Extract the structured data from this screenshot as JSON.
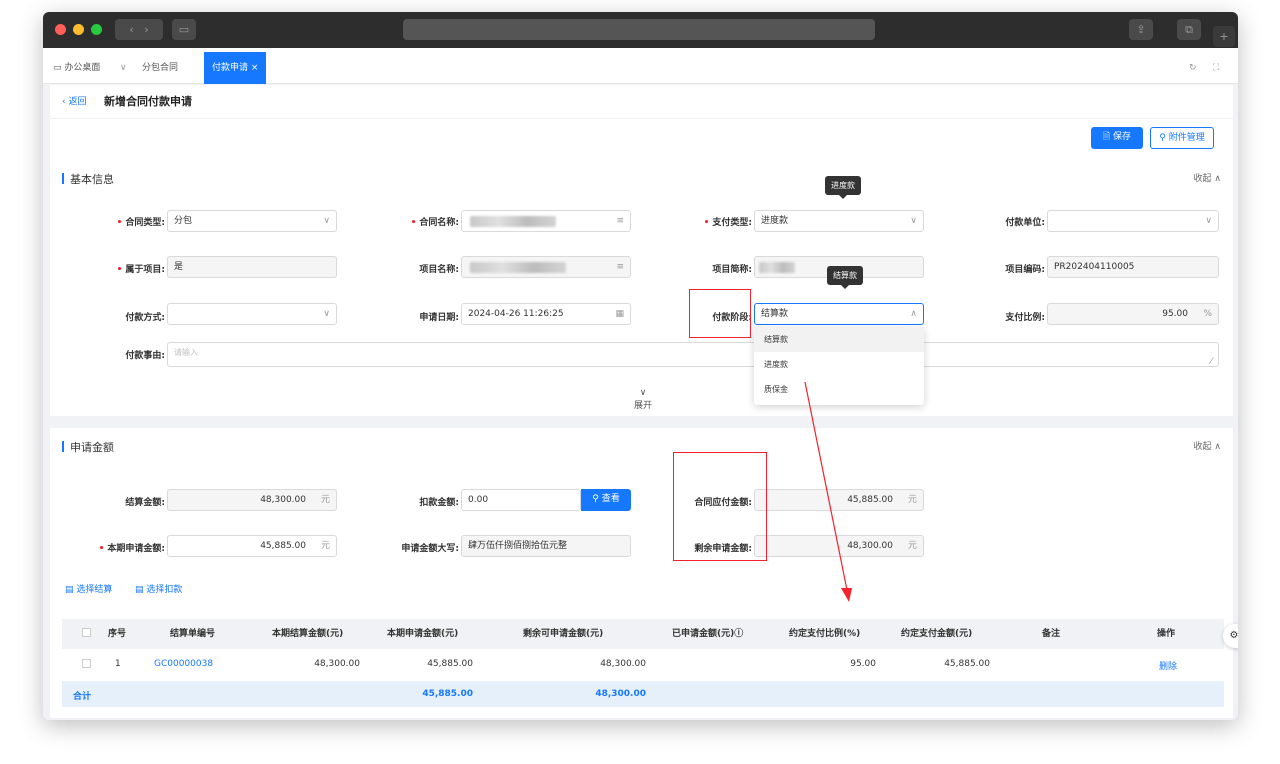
{
  "tabs": {
    "home": "办公桌面",
    "contract": "分包合同",
    "active": "付款申请",
    "active_close": "×"
  },
  "page": {
    "back": "返回",
    "title": "新增合同付款申请",
    "save": "保存",
    "attach": "附件管理"
  },
  "basic": {
    "title": "基本信息",
    "collapse": "收起",
    "contract_type_label": "合同类型:",
    "contract_type_value": "分包",
    "contract_name_label": "合同名称:",
    "pay_type_label": "支付类型:",
    "pay_type_value": "进度款",
    "pay_unit_label": "付款单位:",
    "belong_project_label": "属于项目:",
    "belong_project_value": "是",
    "project_name_label": "项目名称:",
    "project_short_label": "项目简称:",
    "project_code_label": "项目编码:",
    "project_code_value": "PR202404110005",
    "pay_method_label": "付款方式:",
    "apply_date_label": "申请日期:",
    "apply_date_value": "2024-04-26 11:26:25",
    "pay_stage_label": "付款阶段:",
    "pay_stage_value": "结算款",
    "pay_ratio_label": "支付比例:",
    "pay_ratio_value": "95.00",
    "pay_ratio_unit": "%",
    "reason_label": "付款事由:",
    "reason_placeholder": "请输入",
    "expand": "展开",
    "tooltip_type": "进度款",
    "tooltip_stage": "结算款",
    "stage_options": [
      "结算款",
      "进度款",
      "质保金"
    ]
  },
  "amount": {
    "title": "申请金额",
    "collapse": "收起",
    "settle_label": "结算金额:",
    "settle_value": "48,300.00",
    "unit": "元",
    "deduct_label": "扣款金额:",
    "deduct_value": "0.00",
    "view_btn": "查看",
    "contract_due_label": "合同应付金额:",
    "contract_due_value": "45,885.00",
    "current_label": "本期申请金额:",
    "current_value": "45,885.00",
    "upper_label": "申请金额大写:",
    "upper_value": "肆万伍仟捌佰捌拾伍元整",
    "remain_label": "剩余申请金额:",
    "remain_value": "48,300.00",
    "select_settle": "选择结算",
    "select_deduct": "选择扣款"
  },
  "table": {
    "headers": [
      "序号",
      "结算单编号",
      "本期结算金额(元)",
      "本期申请金额(元)",
      "剩余可申请金额(元)",
      "已申请金额(元)",
      "约定支付比例(%)",
      "约定支付金额(元)",
      "备注",
      "操作"
    ],
    "rows": [
      {
        "index": "1",
        "code": "GC00000038",
        "settle": "48,300.00",
        "apply": "45,885.00",
        "remain": "48,300.00",
        "applied": "",
        "ratio": "95.00",
        "amount": "45,885.00",
        "remark": "",
        "action": "删除"
      }
    ],
    "total_label": "合计",
    "total_apply": "45,885.00",
    "total_remain": "48,300.00"
  },
  "colors": {
    "primary": "#1677ff",
    "danger": "#f5222d"
  }
}
